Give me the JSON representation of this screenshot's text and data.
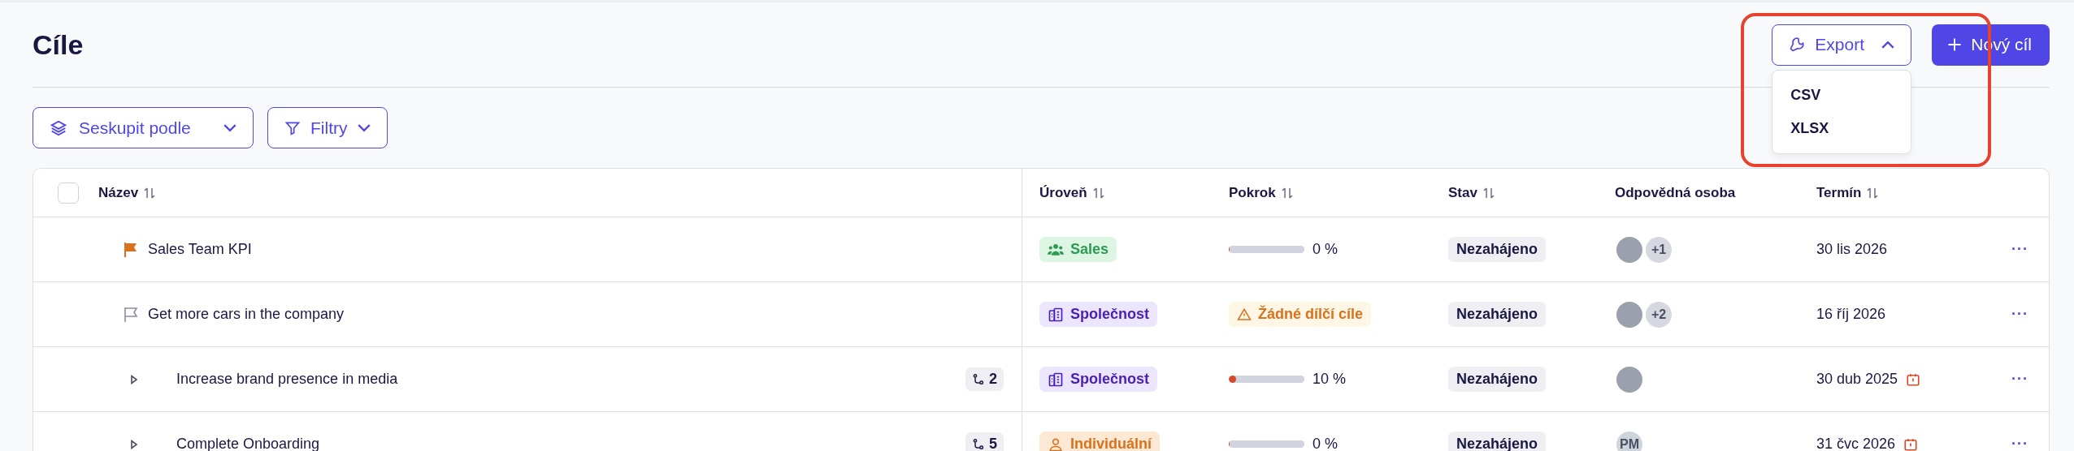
{
  "page": {
    "title": "Cíle"
  },
  "toolbar": {
    "group_by": "Seskupit podle",
    "filters": "Filtry"
  },
  "export": {
    "label": "Export",
    "expanded": true,
    "options": [
      "CSV",
      "XLSX"
    ]
  },
  "new_button": {
    "label": "Nový cíl"
  },
  "table": {
    "select_all": {
      "checked": false
    },
    "columns": [
      {
        "label": "Název",
        "sortable": true
      },
      {
        "label": "Úroveň",
        "sortable": true
      },
      {
        "label": "Pokrok",
        "sortable": true
      },
      {
        "label": "Stav",
        "sortable": true
      },
      {
        "label": "Odpovědná osoba",
        "sortable": false
      },
      {
        "label": "Termín",
        "sortable": true
      }
    ],
    "rows": [
      {
        "kind": "goal",
        "flagged": true,
        "menu": "···",
        "name": "Sales Team KPI",
        "scope": {
          "kind": "team",
          "label": "Sales"
        },
        "progress": {
          "kind": "bar",
          "level": 0,
          "reading": "0 %"
        },
        "status": "Nezahájeno",
        "owners": {
          "avatars": [
            {
              "kind": "photo"
            }
          ],
          "extra": "+1"
        },
        "deadline": "30 lis 2026",
        "overdue": false
      },
      {
        "kind": "goal",
        "flagged": false,
        "menu": "···",
        "name": "Get more cars in the company",
        "scope": {
          "kind": "company",
          "label": "Společnost"
        },
        "progress": {
          "kind": "warning",
          "label": "Žádné dílčí cíle"
        },
        "status": "Nezahájeno",
        "owners": {
          "avatars": [
            {
              "kind": "photo"
            }
          ],
          "extra": "+2"
        },
        "deadline": "16 říj 2026",
        "overdue": false
      },
      {
        "kind": "parent",
        "expanded": false,
        "menu": "···",
        "name": "Increase brand presence in media",
        "subgoals": "2",
        "scope": {
          "kind": "company",
          "label": "Společnost"
        },
        "progress": {
          "kind": "bar",
          "level": 0.1,
          "reading": "10 %"
        },
        "status": "Nezahájeno",
        "owners": {
          "avatars": [
            {
              "kind": "photo"
            }
          ]
        },
        "deadline": "30 dub 2025",
        "overdue": true
      },
      {
        "kind": "parent",
        "expanded": false,
        "menu": "···",
        "name": "Complete Onboarding",
        "subgoals": "5",
        "scope": {
          "kind": "person",
          "label": "Individuální"
        },
        "progress": {
          "kind": "bar",
          "level": 0,
          "reading": "0 %"
        },
        "status": "Nezahájeno",
        "owners": {
          "avatars": [
            {
              "kind": "initials",
              "initials": "PM"
            }
          ]
        },
        "deadline": "31 čvc 2026",
        "overdue": true
      }
    ]
  }
}
